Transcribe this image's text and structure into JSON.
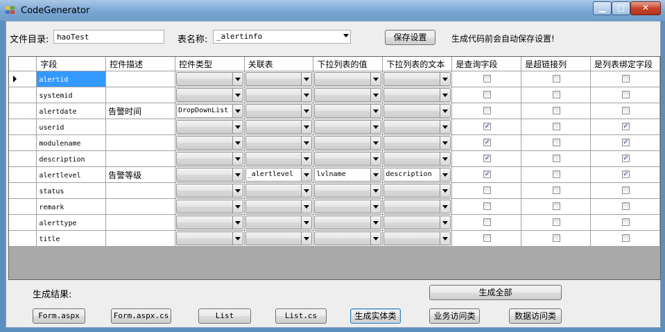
{
  "window": {
    "title": "CodeGenerator",
    "min": "▁",
    "max": "□",
    "close": "✕"
  },
  "form": {
    "dir_label": "文件目录:",
    "dir_value": "haoTest",
    "table_label": "表名称:",
    "table_value": "_alertinfo",
    "save_button": "保存设置",
    "hint": "生成代码前会自动保存设置!"
  },
  "grid": {
    "columns": [
      "字段",
      "控件描述",
      "控件类型",
      "关联表",
      "下拉列表的值",
      "下拉列表的文本",
      "是查询字段",
      "是超链接列",
      "是列表绑定字段"
    ],
    "rows": [
      {
        "field": "alertid",
        "desc": "",
        "type": "",
        "rel": "",
        "val": "",
        "txt": "",
        "q": false,
        "link": false,
        "bind": false
      },
      {
        "field": "systemid",
        "desc": "",
        "type": "",
        "rel": "",
        "val": "",
        "txt": "",
        "q": false,
        "link": false,
        "bind": false
      },
      {
        "field": "alertdate",
        "desc": "告警时间",
        "type": "DropDownList",
        "rel": "",
        "val": "",
        "txt": "",
        "q": false,
        "link": false,
        "bind": false
      },
      {
        "field": "userid",
        "desc": "",
        "type": "",
        "rel": "",
        "val": "",
        "txt": "",
        "q": true,
        "link": false,
        "bind": true
      },
      {
        "field": "modulename",
        "desc": "",
        "type": "",
        "rel": "",
        "val": "",
        "txt": "",
        "q": true,
        "link": false,
        "bind": true
      },
      {
        "field": "description",
        "desc": "",
        "type": "",
        "rel": "",
        "val": "",
        "txt": "",
        "q": true,
        "link": false,
        "bind": true
      },
      {
        "field": "alertlevel",
        "desc": "告警等级",
        "type": "",
        "rel": "_alertlevel",
        "val": "lvlname",
        "txt": "description",
        "q": true,
        "link": false,
        "bind": true
      },
      {
        "field": "status",
        "desc": "",
        "type": "",
        "rel": "",
        "val": "",
        "txt": "",
        "q": false,
        "link": false,
        "bind": false
      },
      {
        "field": "remark",
        "desc": "",
        "type": "",
        "rel": "",
        "val": "",
        "txt": "",
        "q": false,
        "link": false,
        "bind": false
      },
      {
        "field": "alerttype",
        "desc": "",
        "type": "",
        "rel": "",
        "val": "",
        "txt": "",
        "q": false,
        "link": false,
        "bind": false
      },
      {
        "field": "title",
        "desc": "",
        "type": "",
        "rel": "",
        "val": "",
        "txt": "",
        "q": false,
        "link": false,
        "bind": false
      }
    ],
    "selected_row": 0
  },
  "bottom": {
    "result_label": "生成结果:",
    "generate_all": "生成全部",
    "buttons": [
      "Form.aspx",
      "Form.aspx.cs",
      "List",
      "List.cs",
      "生成实体类",
      "业务访问类",
      "数据访问类"
    ]
  },
  "colors": {
    "selection": "#3399ff",
    "title_bar": "#7aa6d3",
    "close_button": "#c7442c"
  }
}
